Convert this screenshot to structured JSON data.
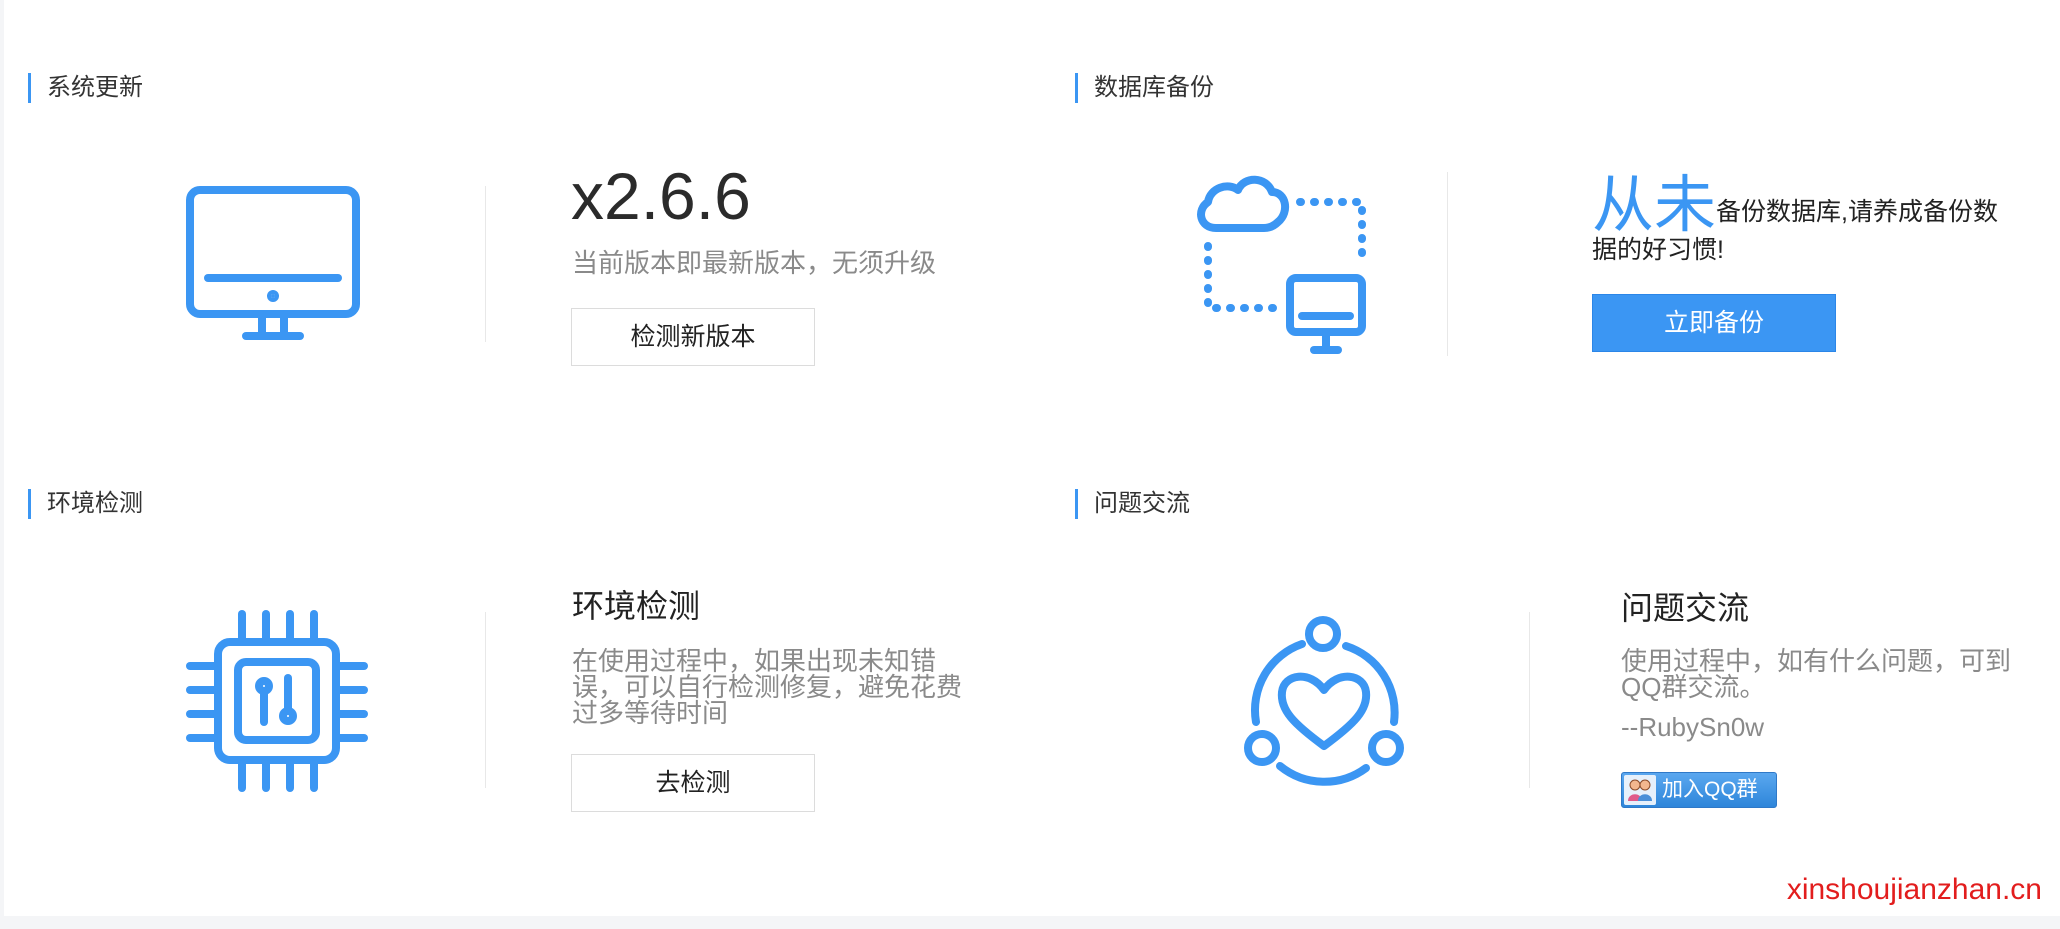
{
  "sections": {
    "update": {
      "title": "系统更新",
      "version": "x2.6.6",
      "message": "当前版本即最新版本，无须升级",
      "button": "检测新版本",
      "icon": "monitor-icon"
    },
    "backup": {
      "title": "数据库备份",
      "accent": "从未",
      "message": "备份数据库,请养成备份数据的好习惯!",
      "button": "立即备份",
      "icon": "cloud-sync-icon"
    },
    "env": {
      "title": "环境检测",
      "heading": "环境检测",
      "message": "在使用过程中，如果出现未知错误，可以自行检测修复，避免花费过多等待时间",
      "button": "去检测",
      "icon": "chip-icon"
    },
    "support": {
      "title": "问题交流",
      "heading": "问题交流",
      "message": "使用过程中，如有什么问题，可到QQ群交流。",
      "author": "--RubySn0w",
      "qq_button": "加入QQ群",
      "icon": "heart-community-icon"
    }
  },
  "watermark": "xinshoujianzhan.cn",
  "colors": {
    "accent": "#3b96f3",
    "watermark": "#e21d1d"
  }
}
